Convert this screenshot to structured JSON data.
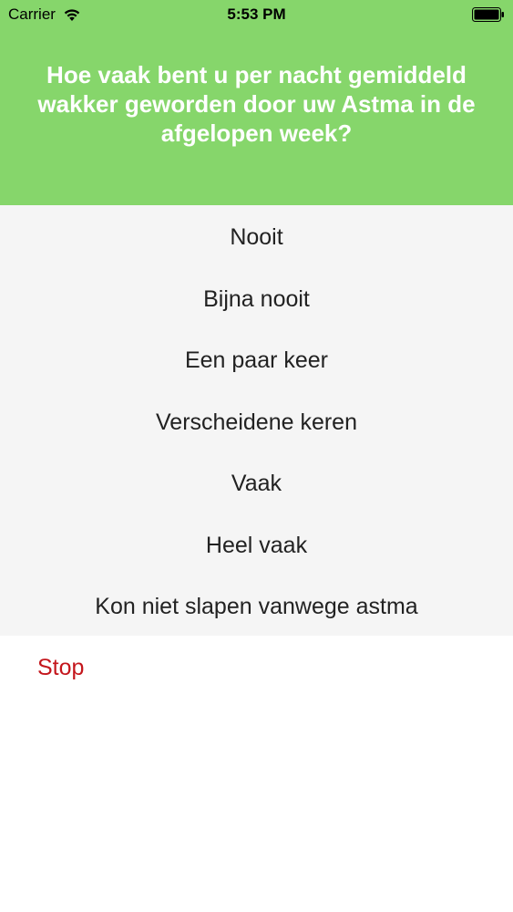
{
  "status_bar": {
    "carrier": "Carrier",
    "time": "5:53 PM",
    "icons": [
      "wifi-icon",
      "battery-icon"
    ]
  },
  "header": {
    "background_color": "#86d66b",
    "question": "Hoe vaak bent u per nacht gemiddeld wakker geworden door uw Astma in de afgelopen week?"
  },
  "options": [
    "Nooit",
    "Bijna nooit",
    "Een paar keer",
    "Verscheidene keren",
    "Vaak",
    "Heel vaak",
    "Kon niet slapen vanwege astma"
  ],
  "footer": {
    "stop_label": "Stop",
    "stop_color": "#c4161c"
  }
}
